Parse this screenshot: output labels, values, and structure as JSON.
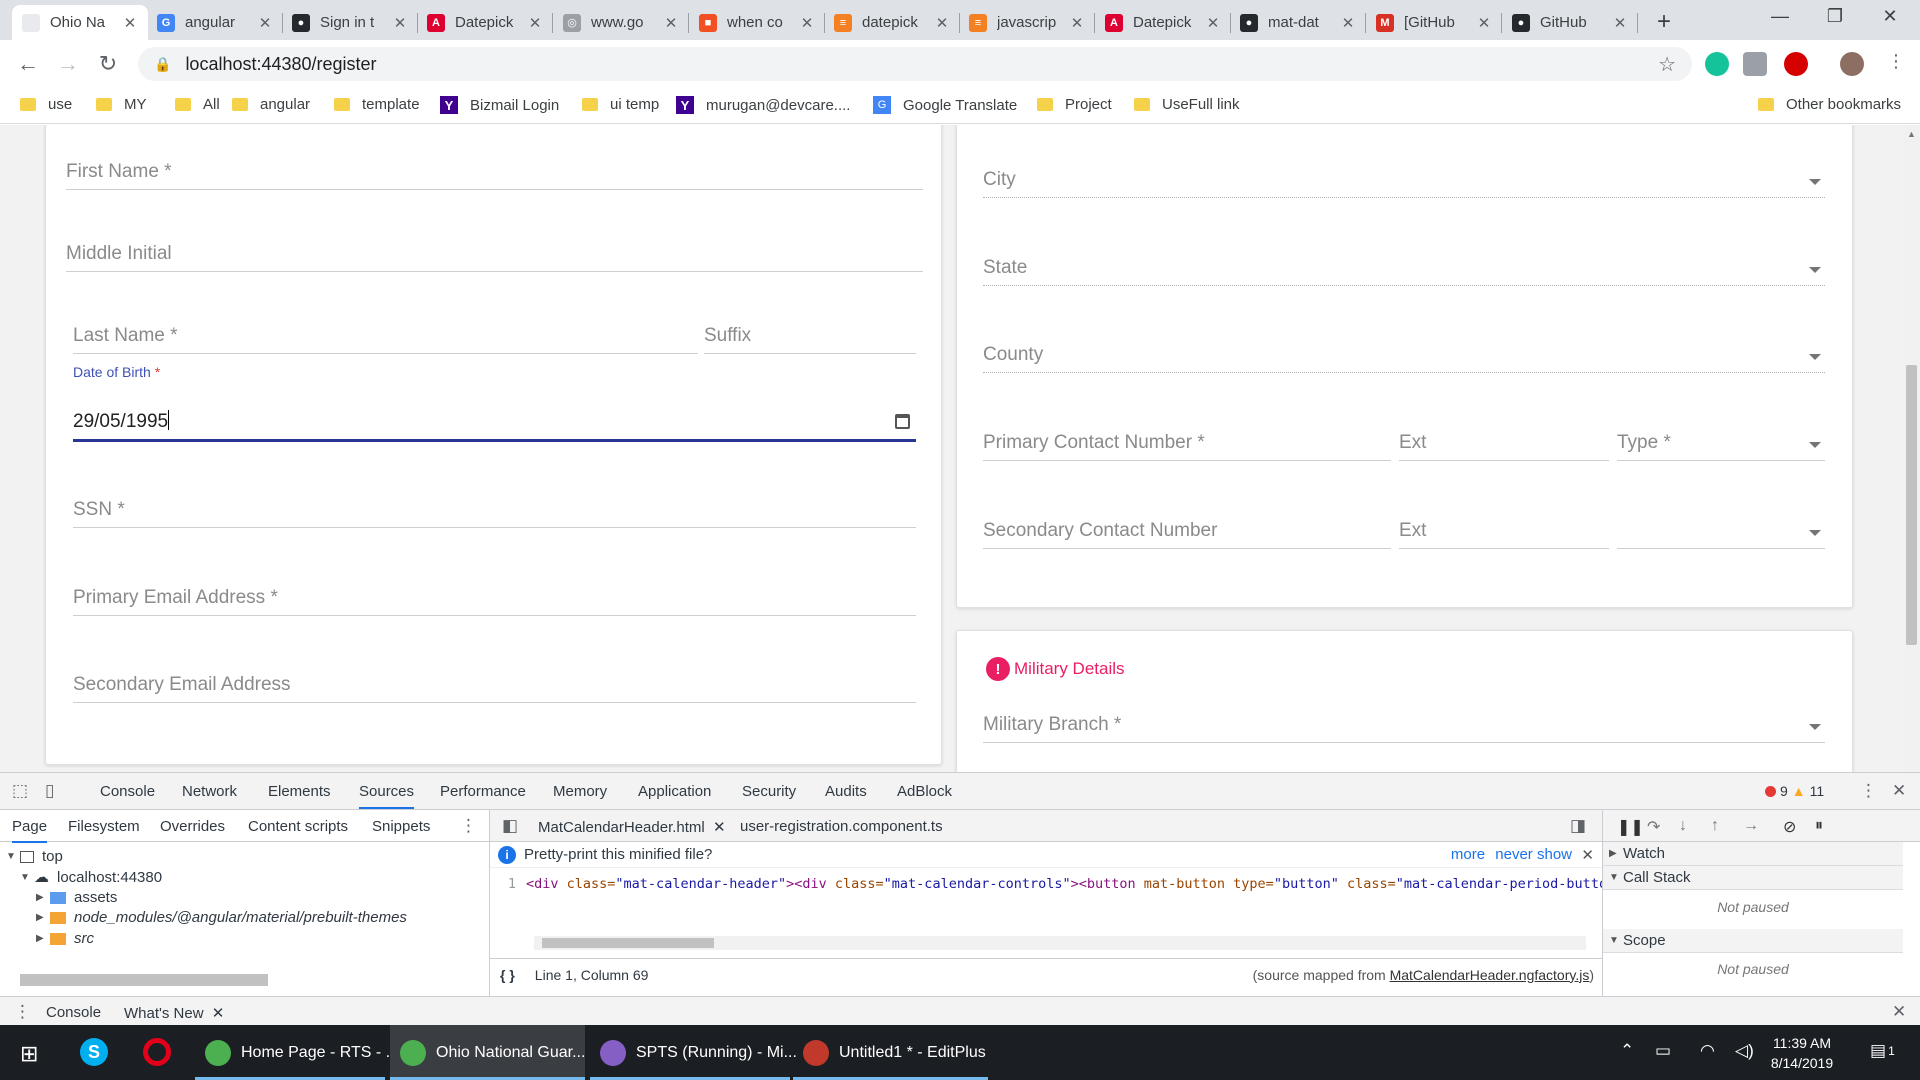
{
  "browser": {
    "tabs": [
      {
        "label": "Ohio Na",
        "icon": "ohio-favicon-icon",
        "color": "#e8eaed",
        "glyph": "",
        "active": true
      },
      {
        "label": "angular",
        "icon": "google-icon",
        "color": "#4285f4",
        "glyph": "G"
      },
      {
        "label": "Sign in t",
        "icon": "github-icon",
        "color": "#24292e",
        "glyph": "●"
      },
      {
        "label": "Datepick",
        "icon": "angular-icon",
        "color": "#dd0031",
        "glyph": "A"
      },
      {
        "label": "www.go",
        "icon": "globe-icon",
        "color": "#9aa0a6",
        "glyph": "◎"
      },
      {
        "label": "when co",
        "icon": "microsoft-icon",
        "color": "#f25022",
        "glyph": "■"
      },
      {
        "label": "datepick",
        "icon": "stackoverflow-icon",
        "color": "#f48024",
        "glyph": "≡"
      },
      {
        "label": "javascrip",
        "icon": "stackoverflow-icon",
        "color": "#f48024",
        "glyph": "≡"
      },
      {
        "label": "Datepick",
        "icon": "angular-icon",
        "color": "#dd0031",
        "glyph": "A"
      },
      {
        "label": "mat-dat",
        "icon": "github-icon",
        "color": "#24292e",
        "glyph": "●"
      },
      {
        "label": "[GitHub",
        "icon": "gmail-icon",
        "color": "#d93025",
        "glyph": "M"
      },
      {
        "label": "GitHub",
        "icon": "github-icon",
        "color": "#24292e",
        "glyph": "●"
      }
    ],
    "new_tab_glyph": "+",
    "url": "localhost:44380/register",
    "bookmarks": [
      {
        "label": "use",
        "type": "folder"
      },
      {
        "label": "MY",
        "type": "folder"
      },
      {
        "label": "All",
        "type": "folder"
      },
      {
        "label": "angular",
        "type": "folder"
      },
      {
        "label": "template",
        "type": "folder"
      },
      {
        "label": "Bizmail Login",
        "type": "yahoo"
      },
      {
        "label": "ui temp",
        "type": "folder"
      },
      {
        "label": "murugan@devcare....",
        "type": "yahoo"
      },
      {
        "label": "Google Translate",
        "type": "translate"
      },
      {
        "label": "Project",
        "type": "folder"
      },
      {
        "label": "UseFull link",
        "type": "folder"
      }
    ],
    "other_bookmarks": "Other bookmarks"
  },
  "form_left": {
    "first_name": "First Name *",
    "middle_initial": "Middle Initial",
    "last_name": "Last Name *",
    "suffix": "Suffix",
    "dob_label": "Date of Birth",
    "dob_required": " *",
    "dob_value": "29/05/1995",
    "ssn": "SSN *",
    "primary_email": "Primary Email Address *",
    "secondary_email": "Secondary Email Address"
  },
  "form_right": {
    "city": "City",
    "state": "State",
    "county": "County",
    "primary_contact": "Primary Contact Number *",
    "ext1": "Ext",
    "type": "Type *",
    "secondary_contact": "Secondary Contact Number",
    "ext2": "Ext",
    "military_title": "Military Details",
    "military_branch": "Military Branch *"
  },
  "devtools": {
    "tabs": [
      "Console",
      "Network",
      "Elements",
      "Sources",
      "Performance",
      "Memory",
      "Application",
      "Security",
      "Audits",
      "AdBlock"
    ],
    "active_tab": "Sources",
    "errors": "9",
    "warnings": "11",
    "nav_tabs": [
      "Page",
      "Filesystem",
      "Overrides",
      "Content scripts",
      "Snippets"
    ],
    "tree": {
      "top": "top",
      "host": "localhost:44380",
      "assets": "assets",
      "node_modules": "node_modules/@angular/material/prebuilt-themes",
      "src": "src"
    },
    "editor_tabs": [
      "MatCalendarHeader.html",
      "user-registration.component.ts"
    ],
    "pretty_print_prompt": "Pretty-print this minified file?",
    "more": "more",
    "never_show": "never show",
    "line_number": "1",
    "code": {
      "t1": "<div ",
      "a1": "class=",
      "s1": "\"mat-calendar-header\"",
      "t2": "><div ",
      "a2": "class=",
      "s2": "\"mat-calendar-controls\"",
      "t3": "><button ",
      "a3": "mat-button type=",
      "s3": "\"button\"",
      "a4": " class=",
      "s4": "\"mat-calendar-period-button\""
    },
    "position": "Line 1, Column 69",
    "source_mapped_prefix": "(source mapped from ",
    "source_mapped_file": "MatCalendarHeader.ngfactory.js",
    "source_mapped_suffix": ")",
    "watch": "Watch",
    "call_stack": "Call Stack",
    "not_paused_1": "Not paused",
    "scope": "Scope",
    "not_paused_2": "Not paused",
    "drawer_tabs": [
      "Console",
      "What's New"
    ]
  },
  "taskbar": {
    "items": [
      {
        "label": "Home Page - RTS - ...",
        "icon": "chrome-icon",
        "color": "#4caf50"
      },
      {
        "label": "Ohio National Guar...",
        "icon": "chrome-icon",
        "color": "#4caf50",
        "active": true
      },
      {
        "label": "SPTS (Running) - Mi...",
        "icon": "visual-studio-icon",
        "color": "#865fc5"
      },
      {
        "label": "Untitled1 * - EditPlus",
        "icon": "editplus-icon",
        "color": "#c0392b"
      }
    ],
    "time": "11:39 AM",
    "date": "8/14/2019",
    "notification_count": "1"
  },
  "colors": {
    "accent": "#3f51b5",
    "focus_underline": "#283593",
    "error": "#e91e63"
  }
}
